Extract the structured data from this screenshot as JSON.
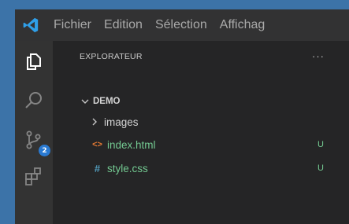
{
  "menubar": {
    "items": [
      "Fichier",
      "Edition",
      "Sélection",
      "Affichag"
    ]
  },
  "activitybar": {
    "items": [
      {
        "icon": "files-icon"
      },
      {
        "icon": "search-icon"
      },
      {
        "icon": "source-control-icon",
        "badge": "2"
      },
      {
        "icon": "extensions-icon"
      }
    ]
  },
  "explorer": {
    "title": "EXPLORATEUR",
    "more_label": "···",
    "root_folder": "DEMO",
    "tree": [
      {
        "type": "folder",
        "label": "images"
      },
      {
        "type": "file",
        "label": "index.html",
        "icon": "html-file-icon",
        "icon_glyph": "<>",
        "status": "U"
      },
      {
        "type": "file",
        "label": "style.css",
        "icon": "css-file-icon",
        "icon_glyph": "#",
        "status": "U"
      }
    ]
  },
  "colors": {
    "accent": "#2a7ad2",
    "untracked_file": "#73c991",
    "background": "#252526",
    "titlebar": "#323233",
    "activitybar": "#333333"
  }
}
